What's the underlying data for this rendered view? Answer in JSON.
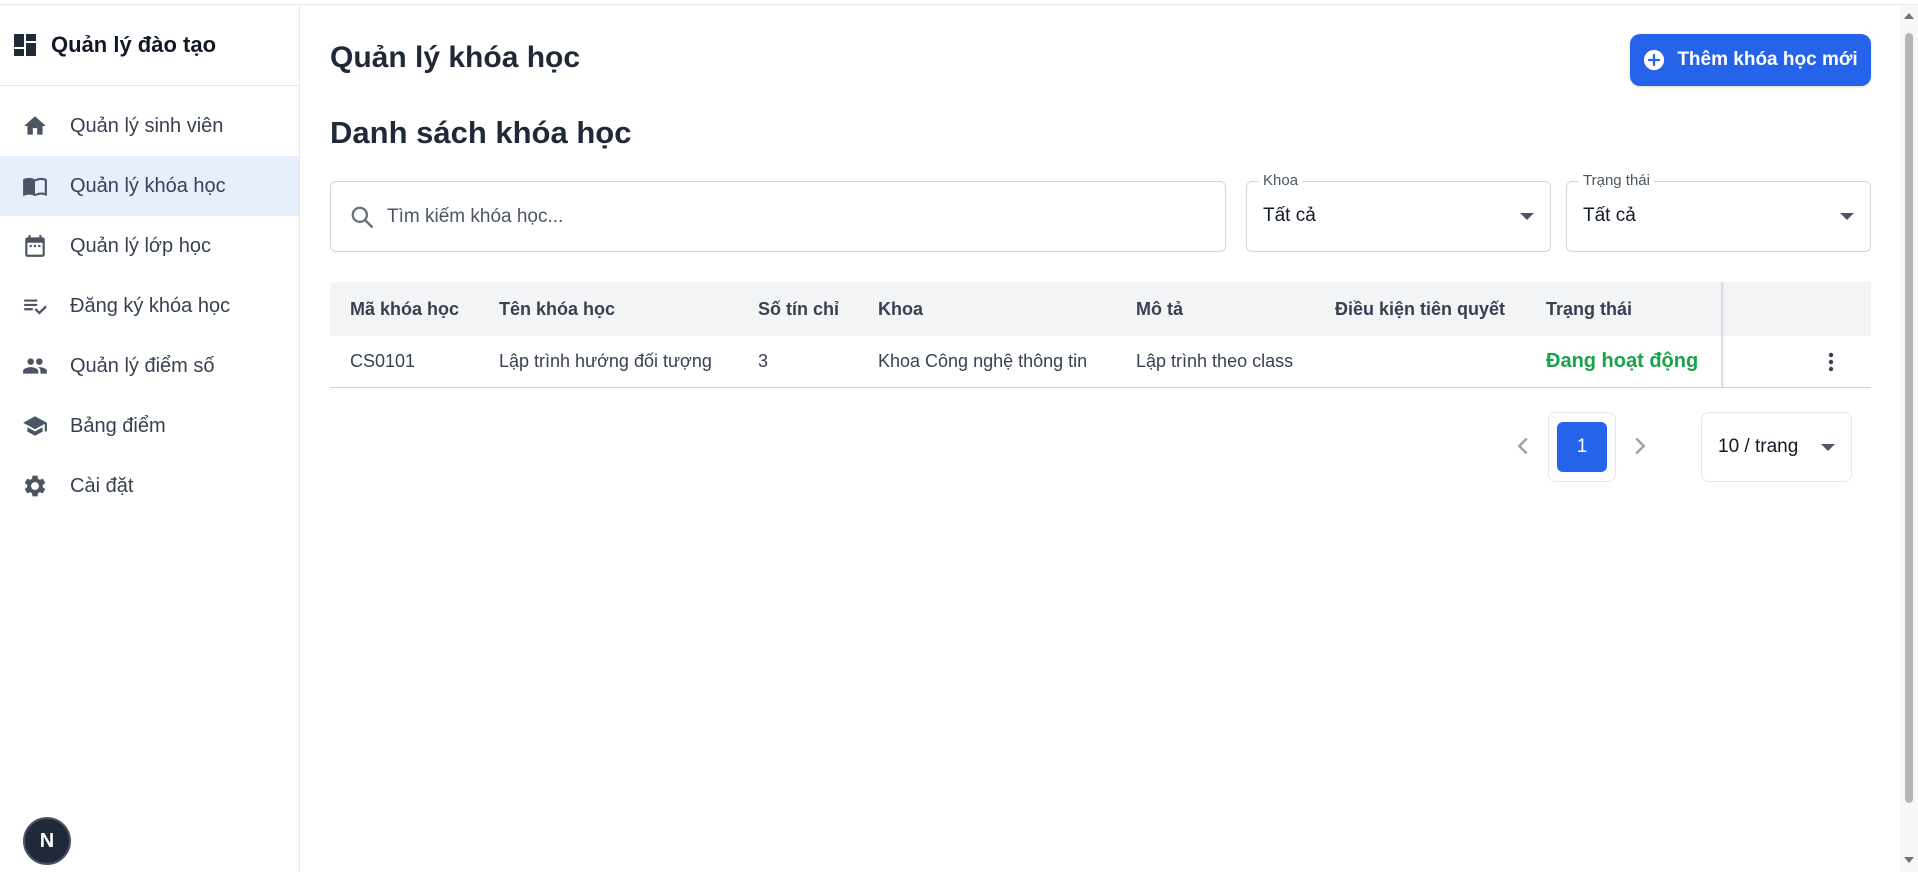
{
  "app": {
    "brand_title": "Quản lý đào tạo",
    "brand_icon": "dashboard-icon"
  },
  "sidebar": {
    "items": [
      {
        "label": "Quản lý sinh viên",
        "icon": "home-icon",
        "active": false
      },
      {
        "label": "Quản lý khóa học",
        "icon": "book-icon",
        "active": true
      },
      {
        "label": "Quản lý lớp học",
        "icon": "calendar-icon",
        "active": false
      },
      {
        "label": "Đăng ký khóa học",
        "icon": "list-check-icon",
        "active": false
      },
      {
        "label": "Quản lý điểm số",
        "icon": "people-icon",
        "active": false
      },
      {
        "label": "Bảng điểm",
        "icon": "school-icon",
        "active": false
      },
      {
        "label": "Cài đặt",
        "icon": "gear-icon",
        "active": false
      }
    ],
    "avatar_letter": "N"
  },
  "header": {
    "page_title": "Quản lý khóa học",
    "add_button_label": "Thêm khóa học mới"
  },
  "main": {
    "section_title": "Danh sách khóa học",
    "search": {
      "placeholder": "Tìm kiếm khóa học...",
      "value": ""
    },
    "filters": {
      "department": {
        "label": "Khoa",
        "value": "Tất cả"
      },
      "status": {
        "label": "Trạng thái",
        "value": "Tất cả"
      }
    }
  },
  "table": {
    "columns": [
      "Mã khóa học",
      "Tên khóa học",
      "Số tín chỉ",
      "Khoa",
      "Mô tả",
      "Điều kiện tiên quyết",
      "Trạng thái"
    ],
    "rows": [
      [
        "CS0101",
        "Lập trình hướng đối tượng",
        "3",
        "Khoa Công nghệ thông tin",
        "Lập trình theo class",
        "",
        "Đang hoạt động"
      ]
    ]
  },
  "pagination": {
    "current_page": "1",
    "page_size": "10 / trang"
  },
  "colors": {
    "accent": "#2563eb",
    "active_bg": "#e8effc",
    "status_active": "#16a34a"
  }
}
